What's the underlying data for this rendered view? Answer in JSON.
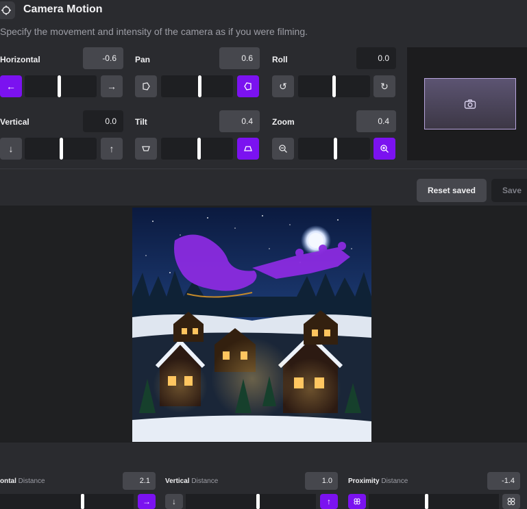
{
  "header": {
    "title": "Camera Motion",
    "subtitle": "Specify the movement and intensity of the camera as if you were filming."
  },
  "controls": {
    "horizontal": {
      "label": "Horizontal",
      "value": "-0.6",
      "left_icon": "arrow-left-icon",
      "right_icon": "arrow-right-icon",
      "active": "left",
      "level": 0.45
    },
    "pan": {
      "label": "Pan",
      "value": "0.6",
      "left_icon": "pan-left-icon",
      "right_icon": "pan-right-icon",
      "active": "right",
      "level": 0.53
    },
    "roll": {
      "label": "Roll",
      "value": "0.0",
      "left_icon": "rotate-ccw-icon",
      "right_icon": "rotate-cw-icon",
      "active": "none",
      "level": 0.5
    },
    "vertical": {
      "label": "Vertical",
      "value": "0.0",
      "left_icon": "arrow-down-icon",
      "right_icon": "arrow-up-icon",
      "active": "none",
      "level": 0.5
    },
    "tilt": {
      "label": "Tilt",
      "value": "0.4",
      "left_icon": "tilt-down-icon",
      "right_icon": "tilt-up-icon",
      "active": "right",
      "level": 0.52
    },
    "zoom": {
      "label": "Zoom",
      "value": "0.4",
      "left_icon": "zoom-out-icon",
      "right_icon": "zoom-in-icon",
      "active": "right",
      "level": 0.52
    }
  },
  "preview": {
    "icon": "camera-icon"
  },
  "actions": {
    "reset_label": "Reset saved",
    "save_label": "Save"
  },
  "bottom": {
    "horizontal": {
      "bold": "ontal",
      "rest": " Distance",
      "value": "2.1"
    },
    "vertical": {
      "bold": "Vertical",
      "rest": " Distance",
      "value": "1.0"
    },
    "proximity": {
      "bold": "Proximity",
      "rest": " Distance",
      "value": "-1.4"
    }
  },
  "colors": {
    "accent": "#7b12f0",
    "panel": "#46474d",
    "background": "#2a2b2f"
  }
}
